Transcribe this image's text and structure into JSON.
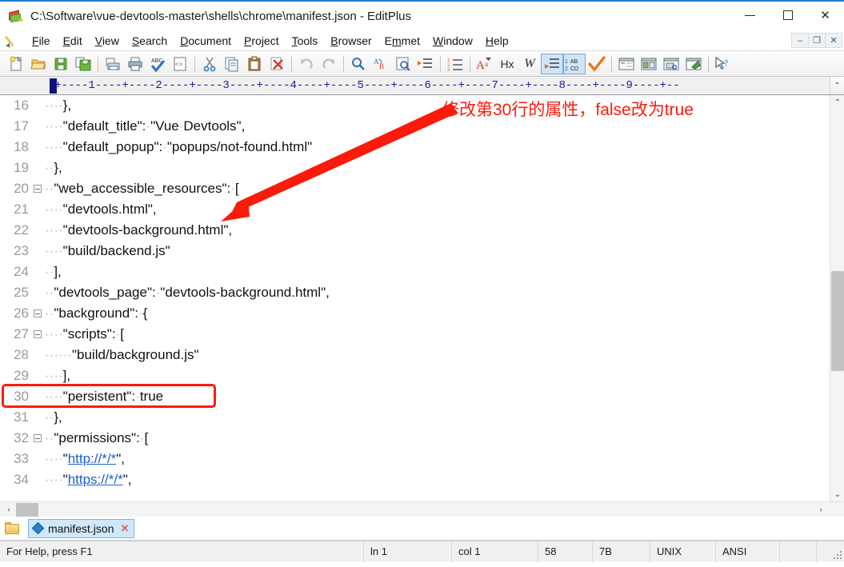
{
  "window": {
    "title": "C:\\Software\\vue-devtools-master\\shells\\chrome\\manifest.json - EditPlus",
    "app_icon": "editplus-books-icon",
    "controls": {
      "minimize": "minimize-icon",
      "maximize": "maximize-icon",
      "close": "close-icon"
    },
    "mdi_controls": {
      "minimize": "–",
      "restore": "❐",
      "close": "✕"
    }
  },
  "menu": {
    "icon": "pencil-icon",
    "items": [
      {
        "label": "File",
        "mnemonic": "F"
      },
      {
        "label": "Edit",
        "mnemonic": "E"
      },
      {
        "label": "View",
        "mnemonic": "V"
      },
      {
        "label": "Search",
        "mnemonic": "S"
      },
      {
        "label": "Document",
        "mnemonic": "D"
      },
      {
        "label": "Project",
        "mnemonic": "P"
      },
      {
        "label": "Tools",
        "mnemonic": "T"
      },
      {
        "label": "Browser",
        "mnemonic": "B"
      },
      {
        "label": "Emmet",
        "mnemonic": "m"
      },
      {
        "label": "Window",
        "mnemonic": "W"
      },
      {
        "label": "Help",
        "mnemonic": "H"
      }
    ]
  },
  "toolbar": {
    "buttons": [
      {
        "name": "new-file-icon",
        "tip": "New"
      },
      {
        "name": "open-file-icon",
        "tip": "Open"
      },
      {
        "name": "save-icon",
        "tip": "Save"
      },
      {
        "name": "save-all-icon",
        "tip": "Save All"
      },
      {
        "sep": true
      },
      {
        "name": "print-preview-icon",
        "tip": "Print Preview"
      },
      {
        "name": "print-icon",
        "tip": "Print"
      },
      {
        "name": "spell-check-icon",
        "tip": "Spell Check"
      },
      {
        "name": "view-source-icon",
        "tip": "View in Browser"
      },
      {
        "sep": true
      },
      {
        "name": "cut-icon",
        "tip": "Cut"
      },
      {
        "name": "copy-icon",
        "tip": "Copy"
      },
      {
        "name": "paste-icon",
        "tip": "Paste"
      },
      {
        "name": "delete-icon",
        "tip": "Delete"
      },
      {
        "sep": true
      },
      {
        "name": "undo-icon",
        "tip": "Undo"
      },
      {
        "name": "redo-icon",
        "tip": "Redo"
      },
      {
        "sep": true
      },
      {
        "name": "find-icon",
        "tip": "Find"
      },
      {
        "name": "replace-icon",
        "tip": "Replace",
        "label": "AₐB"
      },
      {
        "name": "find-in-files-icon",
        "tip": "Find in Files"
      },
      {
        "name": "goto-line-icon",
        "tip": "Go To Line"
      },
      {
        "sep": true
      },
      {
        "name": "line-numbers-icon",
        "tip": "Line Numbers"
      },
      {
        "sep": true
      },
      {
        "name": "change-case-icon",
        "tip": "Change Case",
        "label": "Aᵃ"
      },
      {
        "name": "hex-view-icon",
        "tip": "Hex Viewer",
        "label": "Hx"
      },
      {
        "name": "word-wrap-icon",
        "tip": "Word Wrap",
        "label": "W"
      },
      {
        "name": "indent-icon",
        "tip": "Indent",
        "active": true
      },
      {
        "name": "sort-icon",
        "tip": "Sort",
        "active": true
      },
      {
        "name": "check-icon",
        "tip": "Validate"
      },
      {
        "sep": true
      },
      {
        "name": "directory-window-icon",
        "tip": "Directory Window"
      },
      {
        "name": "cliptext-window-icon",
        "tip": "Cliptext Window"
      },
      {
        "name": "document-selector-icon",
        "tip": "Document Selector"
      },
      {
        "name": "output-window-icon",
        "tip": "Output Window"
      },
      {
        "sep": true
      },
      {
        "name": "context-help-icon",
        "tip": "Help"
      }
    ]
  },
  "ruler": {
    "marks": "-+----1----+----2----+----3----+----4----+----5----+----6----+----7----+----8----+----9----+--",
    "scroll_up": "⌃"
  },
  "editor": {
    "lines": [
      {
        "num": "16",
        "fold": false,
        "parts": [
          {
            "t": "ws",
            "v": "····"
          },
          {
            "t": "code",
            "v": "},"
          }
        ]
      },
      {
        "num": "17",
        "fold": false,
        "parts": [
          {
            "t": "ws",
            "v": "····"
          },
          {
            "t": "code",
            "v": "\"default_title\":"
          },
          {
            "t": "ws",
            "v": "·"
          },
          {
            "t": "code",
            "v": "\"Vue"
          },
          {
            "t": "ws",
            "v": "·"
          },
          {
            "t": "code",
            "v": "Devtools\","
          }
        ]
      },
      {
        "num": "18",
        "fold": false,
        "parts": [
          {
            "t": "ws",
            "v": "····"
          },
          {
            "t": "code",
            "v": "\"default_popup\":"
          },
          {
            "t": "ws",
            "v": "·"
          },
          {
            "t": "code",
            "v": "\"popups/not-found.html\""
          }
        ]
      },
      {
        "num": "19",
        "fold": false,
        "parts": [
          {
            "t": "ws",
            "v": "··"
          },
          {
            "t": "code",
            "v": "},"
          }
        ]
      },
      {
        "num": "20",
        "fold": true,
        "parts": [
          {
            "t": "ws",
            "v": "··"
          },
          {
            "t": "code",
            "v": "\"web_accessible_resources\":"
          },
          {
            "t": "ws",
            "v": "·"
          },
          {
            "t": "code",
            "v": "["
          }
        ]
      },
      {
        "num": "21",
        "fold": false,
        "parts": [
          {
            "t": "ws",
            "v": "····"
          },
          {
            "t": "code",
            "v": "\"devtools.html\","
          }
        ]
      },
      {
        "num": "22",
        "fold": false,
        "parts": [
          {
            "t": "ws",
            "v": "····"
          },
          {
            "t": "code",
            "v": "\"devtools-background.html\","
          }
        ]
      },
      {
        "num": "23",
        "fold": false,
        "parts": [
          {
            "t": "ws",
            "v": "····"
          },
          {
            "t": "code",
            "v": "\"build/backend.js\""
          }
        ]
      },
      {
        "num": "24",
        "fold": false,
        "parts": [
          {
            "t": "ws",
            "v": "··"
          },
          {
            "t": "code",
            "v": "],"
          }
        ]
      },
      {
        "num": "25",
        "fold": false,
        "parts": [
          {
            "t": "ws",
            "v": "··"
          },
          {
            "t": "code",
            "v": "\"devtools_page\":"
          },
          {
            "t": "ws",
            "v": "·"
          },
          {
            "t": "code",
            "v": "\"devtools-background.html\","
          }
        ]
      },
      {
        "num": "26",
        "fold": true,
        "parts": [
          {
            "t": "ws",
            "v": "··"
          },
          {
            "t": "code",
            "v": "\"background\":"
          },
          {
            "t": "ws",
            "v": "·"
          },
          {
            "t": "code",
            "v": "{"
          }
        ]
      },
      {
        "num": "27",
        "fold": true,
        "parts": [
          {
            "t": "ws",
            "v": "····"
          },
          {
            "t": "code",
            "v": "\"scripts\":"
          },
          {
            "t": "ws",
            "v": "·"
          },
          {
            "t": "code",
            "v": "["
          }
        ]
      },
      {
        "num": "28",
        "fold": false,
        "parts": [
          {
            "t": "ws",
            "v": "······"
          },
          {
            "t": "code",
            "v": "\"build/background.js\""
          }
        ]
      },
      {
        "num": "29",
        "fold": false,
        "parts": [
          {
            "t": "ws",
            "v": "····"
          },
          {
            "t": "code",
            "v": "],"
          }
        ]
      },
      {
        "num": "30",
        "fold": false,
        "highlight": true,
        "parts": [
          {
            "t": "ws",
            "v": "····"
          },
          {
            "t": "code",
            "v": "\"persistent\":"
          },
          {
            "t": "ws",
            "v": "·"
          },
          {
            "t": "code",
            "v": "true"
          }
        ]
      },
      {
        "num": "31",
        "fold": false,
        "parts": [
          {
            "t": "ws",
            "v": "··"
          },
          {
            "t": "code",
            "v": "},"
          }
        ]
      },
      {
        "num": "32",
        "fold": true,
        "parts": [
          {
            "t": "ws",
            "v": "··"
          },
          {
            "t": "code",
            "v": "\"permissions\":"
          },
          {
            "t": "ws",
            "v": "·"
          },
          {
            "t": "code",
            "v": "["
          }
        ]
      },
      {
        "num": "33",
        "fold": false,
        "parts": [
          {
            "t": "ws",
            "v": "····"
          },
          {
            "t": "code",
            "v": "\""
          },
          {
            "t": "url",
            "v": "http://*/*"
          },
          {
            "t": "code",
            "v": "\","
          }
        ]
      },
      {
        "num": "34",
        "fold": false,
        "parts": [
          {
            "t": "ws",
            "v": "····"
          },
          {
            "t": "code",
            "v": "\""
          },
          {
            "t": "url",
            "v": "https://*/*"
          },
          {
            "t": "code",
            "v": "\","
          }
        ]
      }
    ]
  },
  "annotation": {
    "text": "修改第30行的属性，false改为true",
    "color": "#fb1a0c",
    "arrow": "red-arrow-pointing-to-line-30",
    "box_target_line": "30"
  },
  "scrollbars": {
    "vertical": {
      "up": "⌃",
      "down": "⌄"
    },
    "horizontal": {
      "left": "‹",
      "right": "›"
    }
  },
  "tabs": {
    "folder_icon": "folder-icon",
    "items": [
      {
        "label": "manifest.json",
        "icon": "json-document-icon",
        "close": "✕",
        "active": true
      }
    ]
  },
  "statusbar": {
    "help": "For Help, press F1",
    "line": "ln 1",
    "col": "col 1",
    "offset": "58",
    "hex": "7B",
    "eol": "UNIX",
    "encoding": "ANSI"
  }
}
